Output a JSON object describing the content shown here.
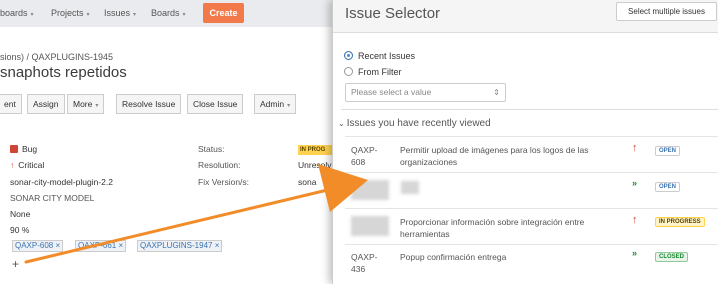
{
  "nav": {
    "items": [
      "boards",
      "Projects",
      "Issues",
      "Boards"
    ],
    "create": "Create"
  },
  "breadcrumb": "sions)  /  QAXPLUGINS-1945",
  "summary": "snaphots repetidos",
  "toolbar": {
    "edit": "ent",
    "assign": "Assign",
    "more": "More",
    "resolve": "Resolve Issue",
    "close": "Close Issue",
    "admin": "Admin"
  },
  "fields": {
    "type": "Bug",
    "priority": "Critical",
    "component": "sonar-city-model-plugin-2.2",
    "model": "SONAR CITY MODEL",
    "none": "None",
    "percent": "90 %",
    "status_label": "Status:",
    "resolution_label": "Resolution:",
    "fixversion_label": "Fix Version/s:",
    "status_value": "IN PROG",
    "resolution_value": "Unresolv",
    "fixversion_value": "sona"
  },
  "tags": [
    "QAXP-608 ×",
    "QAXP-661 ×",
    "QAXPLUGINS-1947 ×"
  ],
  "dialog": {
    "title": "Issue Selector",
    "select_multiple": "Select multiple issues",
    "recent_label": "Recent Issues",
    "filter_label": "From Filter",
    "select_placeholder": "Please select a value",
    "section_title": "Issues you have recently viewed",
    "rows": [
      {
        "key_line1": "QAXP-",
        "key_line2": "608",
        "summary": "Permitir upload de imágenes para los logos de las organizaciones",
        "priority_icon": "arrow-up-icon",
        "status": "OPEN"
      },
      {
        "key_line1": "",
        "key_line2": "",
        "summary": "",
        "priority_icon": "chevron-double-down-icon",
        "status": "OPEN"
      },
      {
        "key_line1": "",
        "key_line2": "",
        "summary": "Proporcionar información sobre integración entre herramientas",
        "priority_icon": "arrow-up-icon",
        "status": "IN PROGRESS"
      },
      {
        "key_line1": "QAXP-",
        "key_line2": "436",
        "summary": "Popup confirmación entrega",
        "priority_icon": "chevron-double-down-icon",
        "status": "CLOSED"
      }
    ]
  },
  "colors": {
    "accent": "#f2794a",
    "link": "#3b73af",
    "critical": "#d04437",
    "low": "#14892c",
    "arrow": "#f28c28"
  }
}
